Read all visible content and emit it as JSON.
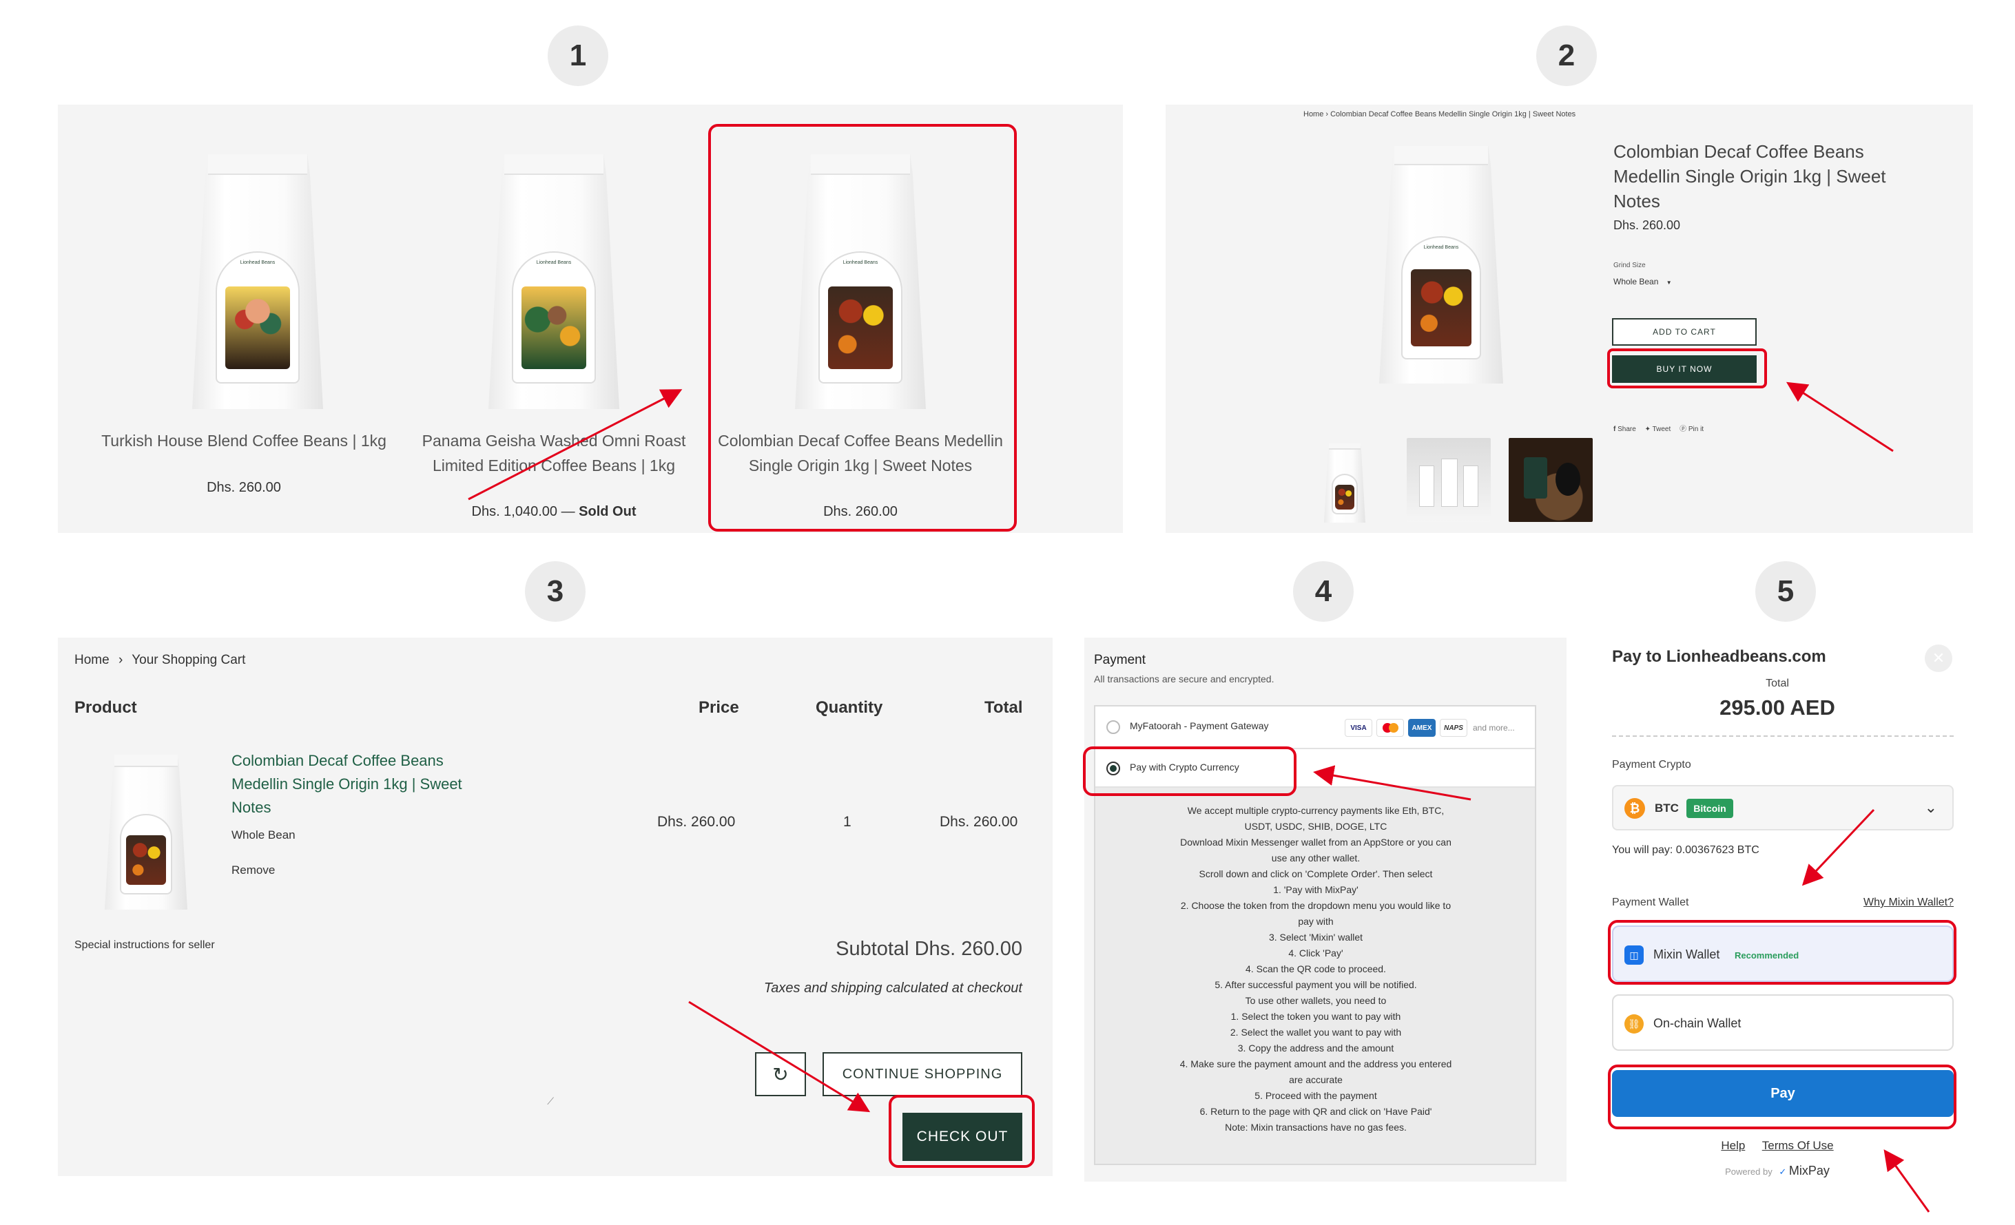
{
  "steps": [
    "1",
    "2",
    "3",
    "4",
    "5"
  ],
  "panel1": {
    "products": [
      {
        "title": "Turkish House Blend Coffee Beans | 1kg",
        "price": "Dhs. 260.00",
        "sold_out": ""
      },
      {
        "title": "Panama Geisha Washed Omni Roast Limited Edition Coffee Beans | 1kg",
        "price": "Dhs. 1,040.00 — ",
        "sold_out": "Sold Out"
      },
      {
        "title": "Colombian Decaf Coffee Beans Medellin Single Origin 1kg | Sweet Notes",
        "price": "Dhs. 260.00",
        "sold_out": ""
      }
    ],
    "bag_brand": "Lionhead Beans"
  },
  "panel2": {
    "breadcrumb": "Home › Colombian Decaf Coffee Beans Medellin Single Origin 1kg | Sweet Notes",
    "title": "Colombian Decaf Coffee Beans Medellin Single Origin 1kg | Sweet Notes",
    "price": "Dhs. 260.00",
    "grind_label": "Grind Size",
    "grind_value": "Whole Bean",
    "add_to_cart": "ADD TO CART",
    "buy_now": "BUY IT NOW",
    "share": "Share",
    "tweet": "Tweet",
    "pin": "Pin it"
  },
  "panel3": {
    "breadcrumb_home": "Home",
    "breadcrumb_sep": "›",
    "breadcrumb_current": "Your Shopping Cart",
    "col_product": "Product",
    "col_price": "Price",
    "col_quantity": "Quantity",
    "col_total": "Total",
    "item_title": "Colombian Decaf Coffee Beans Medellin Single Origin 1kg | Sweet Notes",
    "item_variant": "Whole Bean",
    "item_remove": "Remove",
    "item_price": "Dhs. 260.00",
    "item_qty": "1",
    "item_total": "Dhs. 260.00",
    "special_instructions": "Special instructions for seller",
    "subtotal": "Subtotal Dhs. 260.00",
    "taxes_note": "Taxes and shipping calculated at checkout",
    "continue_shopping": "CONTINUE SHOPPING",
    "checkout": "CHECK OUT"
  },
  "panel4": {
    "title": "Payment",
    "subtitle": "All transactions are secure and encrypted.",
    "option1": "MyFatoorah - Payment Gateway",
    "option2": "Pay with Crypto Currency",
    "and_more": "and more...",
    "card_visa": "VISA",
    "card_amex": "AMEX",
    "card_naps": "NAPS",
    "instructions": [
      "We accept multiple crypto-currency payments like Eth, BTC,",
      "USDT, USDC, SHIB, DOGE, LTC",
      "Download Mixin Messenger wallet from an AppStore or you can",
      "use any other wallet.",
      "Scroll down and click on 'Complete Order'. Then select",
      "1. 'Pay with MixPay'",
      "2. Choose the token from the dropdown menu you would like to",
      "pay with",
      "3. Select 'Mixin' wallet",
      "4. Click 'Pay'",
      "4. Scan the QR code to proceed.",
      "5. After successful payment you will be notified.",
      "To use other wallets, you need to",
      "1. Select the token you want to pay with",
      "2. Select the wallet you want to pay with",
      "3. Copy the address and the amount",
      "4. Make sure the payment amount and the address you entered",
      "are accurate",
      "5. Proceed with the payment",
      "6. Return to the page with QR and click on 'Have Paid'",
      "Note: Mixin transactions have no gas fees."
    ]
  },
  "panel5": {
    "title": "Pay to Lionheadbeans.com",
    "total_label": "Total",
    "total_value": "295.00 AED",
    "crypto_label": "Payment Crypto",
    "coin_symbol": "BTC",
    "coin_name": "Bitcoin",
    "will_pay": "You will pay: 0.00367623 BTC",
    "wallet_label": "Payment Wallet",
    "why_mixin": "Why Mixin Wallet?",
    "mixin_wallet": "Mixin Wallet",
    "recommended": "Recommended",
    "onchain_wallet": "On-chain Wallet",
    "pay": "Pay",
    "help": "Help",
    "terms": "Terms Of Use",
    "powered_by": "Powered by",
    "mixpay": "MixPay"
  },
  "colors": {
    "accent_red": "#e3001b",
    "dark_green": "#1f3d33",
    "pay_blue": "#1877d0",
    "bitcoin": "#f7931a",
    "tag_green": "#2a9d5c"
  }
}
